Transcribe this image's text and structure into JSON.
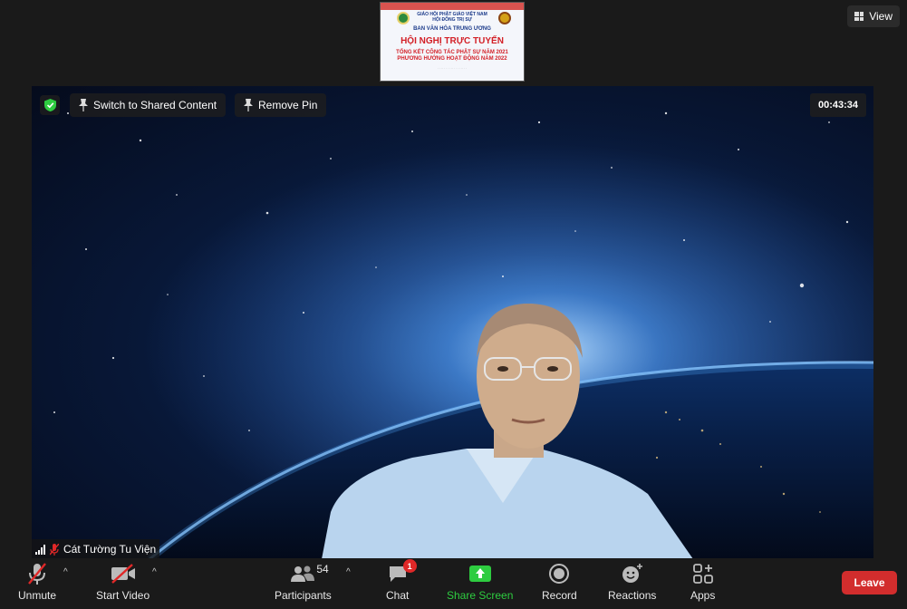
{
  "shared_thumbnail": {
    "org_line1": "GIÁO HỘI PHẬT GIÁO VIỆT NAM",
    "org_line2": "HỘI ĐỒNG TRỊ SỰ",
    "org_line3": "BAN VĂN HÓA TRUNG ƯƠNG",
    "title": "HỘI NGHỊ TRỰC TUYẾN",
    "subtitle1": "TỔNG KẾT CÔNG TÁC PHẬT SỰ NĂM 2021",
    "subtitle2": "PHƯƠNG HƯỚNG HOẠT ĐỘNG NĂM 2022"
  },
  "view_button": {
    "label": "View"
  },
  "video": {
    "switch_label": "Switch to Shared Content",
    "remove_pin_label": "Remove Pin",
    "timer": "00:43:34",
    "participant_name": "Cát Tường Tu Viện"
  },
  "toolbar": {
    "unmute": "Unmute",
    "start_video": "Start Video",
    "participants": "Participants",
    "participants_count": "54",
    "chat": "Chat",
    "chat_badge": "1",
    "share_screen": "Share Screen",
    "record": "Record",
    "reactions": "Reactions",
    "apps": "Apps",
    "leave": "Leave"
  },
  "colors": {
    "accent_green": "#2ecc40",
    "leave_red": "#d22d2d",
    "badge_red": "#e02828"
  }
}
